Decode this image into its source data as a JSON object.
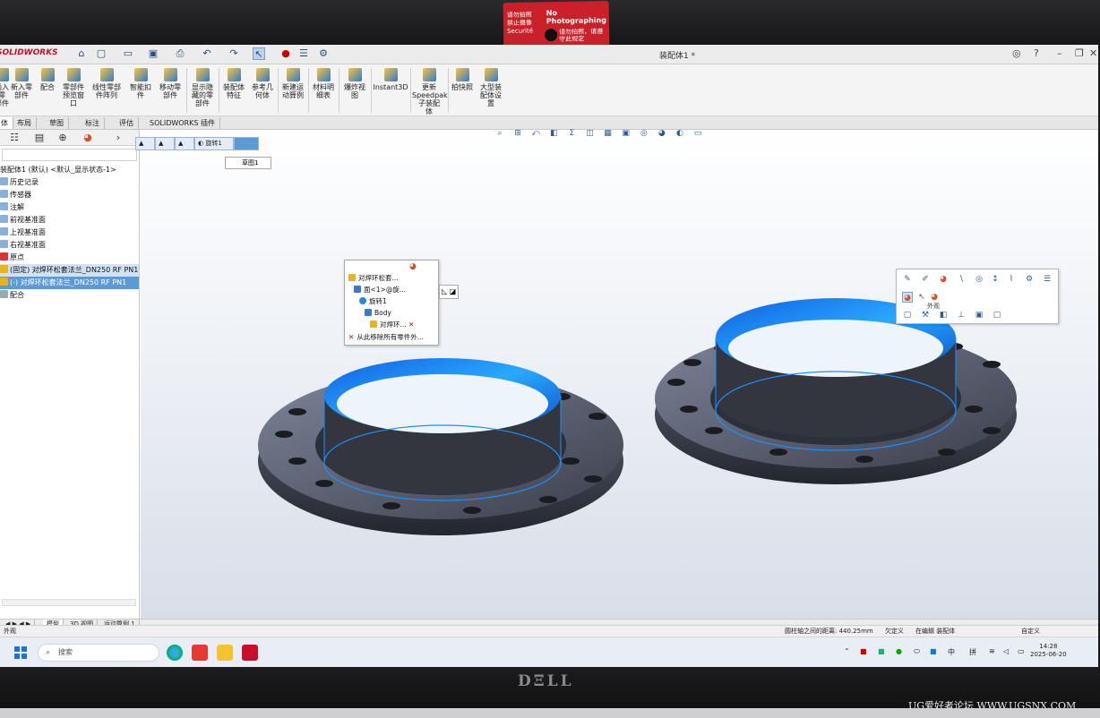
{
  "sticker": {
    "title": "No Photographing",
    "line1": "请勿拍照\n禁止摄像\nSecurité",
    "line2": "请勿拍照，请遵\n守此规定"
  },
  "app": {
    "brand": "SOLIDWORKS",
    "doc_title": "装配体1 *"
  },
  "quick_access": [
    "home-icon",
    "new-icon",
    "open-icon",
    "save-icon",
    "print-icon",
    "undo-icon",
    "redo-icon",
    "select-icon",
    "rebuild-icon",
    "file-props-icon",
    "options-icon"
  ],
  "ribbon": [
    {
      "label": "插入零\n部件"
    },
    {
      "label": "新入零\n部件"
    },
    {
      "label": "配合"
    },
    {
      "label": "零部件\n预览窗\n口"
    },
    {
      "label": "线性零部\n件阵列"
    },
    {
      "label": "智能扣\n件"
    },
    {
      "label": "移动零\n部件"
    },
    {
      "label": "显示隐\n藏的零\n部件"
    },
    {
      "label": "装配体\n特征"
    },
    {
      "label": "参考几\n何体"
    },
    {
      "label": "新建运\n动算例"
    },
    {
      "label": "材料明\n细表"
    },
    {
      "label": "爆炸视\n图"
    },
    {
      "label": "Instant3D"
    },
    {
      "label": "更新\nSpeedpak\n子装配\n体"
    },
    {
      "label": "拍快照"
    },
    {
      "label": "大型装\n配体设\n置"
    }
  ],
  "command_tabs": [
    "体",
    "布局",
    "草图",
    "标注",
    "评估",
    "SOLIDWORKS 插件"
  ],
  "tree": {
    "root": "装配体1 (默认) <默认_显示状态-1>",
    "items": [
      "历史记录",
      "传感器",
      "注解",
      "前视基准面",
      "上视基准面",
      "右视基准面",
      "原点",
      "(固定) 对焊环松套法兰_DN250 RF PN1",
      "(-) 对焊环松套法兰_DN250 RF PN1",
      "配合"
    ]
  },
  "breadcrumb": {
    "feature": "旋转1",
    "sketch": "草图1"
  },
  "context_menu": {
    "header": "对焊环松套...",
    "items": [
      "面<1>@旋...",
      "旋转1",
      "Body",
      "对焊环...",
      "从此移除所有零件外..."
    ]
  },
  "appearance_popup": {
    "tooltip": "外观"
  },
  "bottom_tabs": [
    "模型",
    "3D 视图",
    "运动算例 1"
  ],
  "status": {
    "left": "外观",
    "measure": "圆柱轴之间的距离: 440.25mm",
    "state1": "欠定义",
    "state2": "在编辑 装配体",
    "custom": "自定义"
  },
  "taskbar": {
    "search_placeholder": "搜索",
    "ime1": "中",
    "ime2": "拼",
    "time": "14:28",
    "date": "2025-06-20"
  },
  "watermark": "UG爱好者论坛 WWW.UGSNX.COM",
  "colors": {
    "accent": "#1e90ff",
    "selection": "#5b9bd5",
    "brand": "#c8102e",
    "sticker": "#c9202a"
  }
}
